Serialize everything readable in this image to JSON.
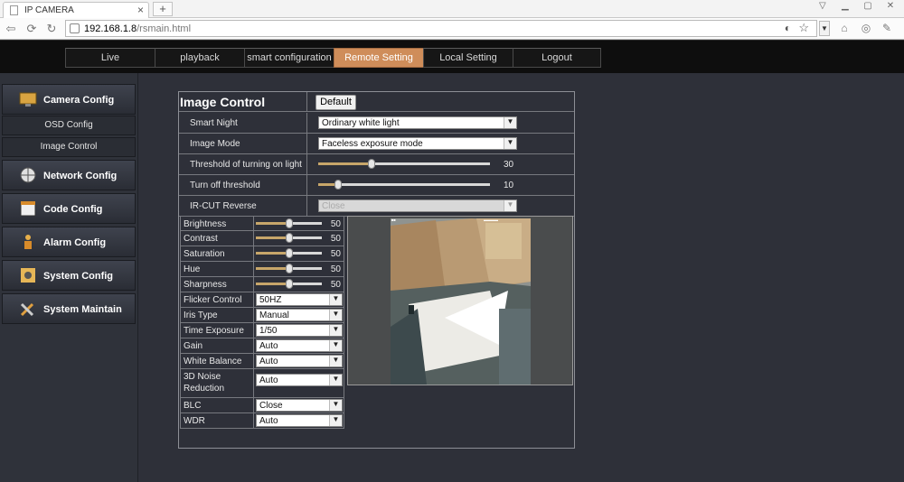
{
  "browser": {
    "tab_title": "IP CAMERA",
    "tab_close": "×",
    "new_tab": "+",
    "url_host": "192.168.1.8",
    "url_path": "/rsmain.html"
  },
  "topnav": {
    "items": [
      {
        "label": "Live"
      },
      {
        "label": "playback"
      },
      {
        "label": "smart configuration"
      },
      {
        "label": "Remote Setting"
      },
      {
        "label": "Local Setting"
      },
      {
        "label": "Logout"
      }
    ],
    "active_index": 3,
    "active_color": "#cf8d5a"
  },
  "sidebar": {
    "camera_config": "Camera Config",
    "osd_config": "OSD Config",
    "image_control": "Image Control",
    "network_config": "Network Config",
    "code_config": "Code Config",
    "alarm_config": "Alarm Config",
    "system_config": "System Config",
    "system_maintain": "System Maintain"
  },
  "panel": {
    "title": "Image Control",
    "default_button": "Default",
    "smart_night": {
      "label": "Smart Night",
      "value": "Ordinary white light"
    },
    "image_mode": {
      "label": "Image Mode",
      "value": "Faceless exposure mode"
    },
    "threshold_on": {
      "label": "Threshold of turning on light",
      "value": "30",
      "fraction": 0.3
    },
    "threshold_off": {
      "label": "Turn off threshold",
      "value": "10",
      "fraction": 0.1
    },
    "ircut": {
      "label": "IR-CUT Reverse",
      "value": "Close"
    }
  },
  "adjust": {
    "brightness": {
      "label": "Brightness",
      "value": "50",
      "fraction": 0.5
    },
    "contrast": {
      "label": "Contrast",
      "value": "50",
      "fraction": 0.5
    },
    "saturation": {
      "label": "Saturation",
      "value": "50",
      "fraction": 0.5
    },
    "hue": {
      "label": "Hue",
      "value": "50",
      "fraction": 0.5
    },
    "sharpness": {
      "label": "Sharpness",
      "value": "50",
      "fraction": 0.5
    },
    "flicker": {
      "label": "Flicker Control",
      "value": "50HZ"
    },
    "iris": {
      "label": "Iris Type",
      "value": "Manual"
    },
    "exposure": {
      "label": "Time Exposure",
      "value": "1/50"
    },
    "gain": {
      "label": "Gain",
      "value": "Auto"
    },
    "white_balance": {
      "label": "White Balance",
      "value": "Auto"
    },
    "noise_reduction": {
      "label_line1": "3D Noise",
      "label_line2": "Reduction",
      "value": "Auto"
    },
    "blc": {
      "label": "BLC",
      "value": "Close"
    },
    "wdr": {
      "label": "WDR",
      "value": "Auto"
    }
  }
}
